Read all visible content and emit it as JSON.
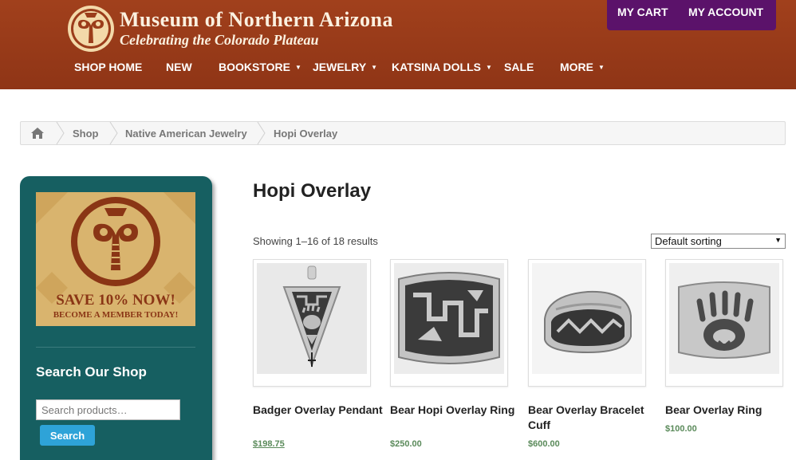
{
  "header": {
    "logo_title": "Museum of Northern Arizona",
    "logo_subtitle": "Celebrating the Colorado Plateau",
    "account_links": {
      "cart": "MY CART",
      "account": "MY ACCOUNT"
    },
    "nav": [
      {
        "label": "SHOP HOME",
        "has_dropdown": false
      },
      {
        "label": "NEW",
        "has_dropdown": false
      },
      {
        "label": "BOOKSTORE",
        "has_dropdown": true
      },
      {
        "label": "JEWELRY",
        "has_dropdown": true
      },
      {
        "label": "KATSINA DOLLS",
        "has_dropdown": true
      },
      {
        "label": "SALE",
        "has_dropdown": false
      },
      {
        "label": "MORE",
        "has_dropdown": true
      }
    ]
  },
  "breadcrumb": {
    "home_icon": "home-icon",
    "items": [
      "Shop",
      "Native American Jewelry",
      "Hopi Overlay"
    ]
  },
  "sidebar": {
    "promo": {
      "line1": "SAVE 10% NOW!",
      "line2": "BECOME A MEMBER TODAY!"
    },
    "search_title": "Search Our Shop",
    "search_placeholder": "Search products…",
    "search_button": "Search"
  },
  "main": {
    "title": "Hopi Overlay",
    "result_count": "Showing 1–16 of 18 results",
    "sort_selected": "Default sorting",
    "products": [
      {
        "name": "Badger Overlay Pendant",
        "price": "$198.75"
      },
      {
        "name": "Bear Hopi Overlay Ring",
        "price": "$250.00"
      },
      {
        "name": "Bear Overlay Bracelet Cuff",
        "price": "$600.00"
      },
      {
        "name": "Bear Overlay Ring",
        "price": "$100.00"
      }
    ]
  },
  "colors": {
    "header_bg": "#9b3c1a",
    "account_bg": "#5b126a",
    "sidebar_bg": "#165f61",
    "search_button": "#2ea3d8",
    "price": "#5a8a5a"
  }
}
